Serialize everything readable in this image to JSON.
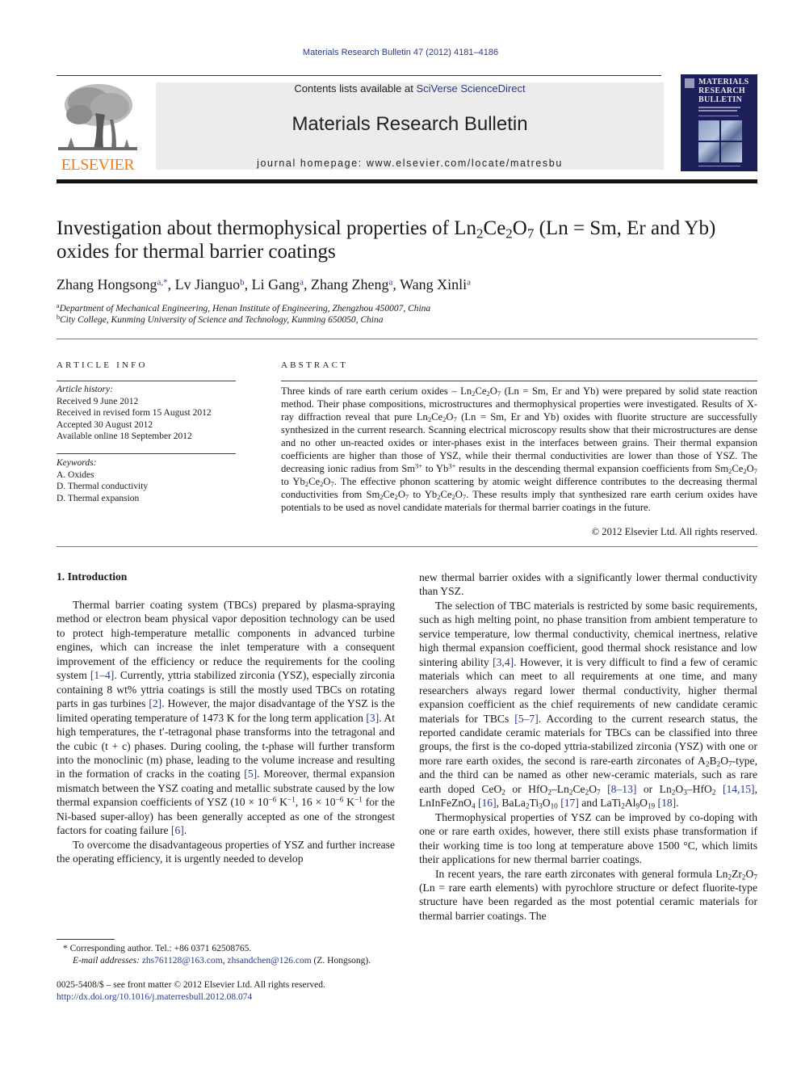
{
  "header": {
    "citation": "Materials Research Bulletin 47 (2012) 4181–4186",
    "publisher_wordmark": "ELSEVIER",
    "contents_prefix": "Contents lists available at ",
    "contents_link": "SciVerse ScienceDirect",
    "journal_title": "Materials Research Bulletin",
    "homepage": "journal homepage: www.elsevier.com/locate/matresbu",
    "cover_title": [
      "MATERIALS",
      "RESEARCH",
      "BULLETIN"
    ],
    "colors": {
      "link": "#2a3a8c",
      "elsevier_orange": "#f07d1a",
      "banner_bg": "#ececec",
      "cover_bg": "#1c1f5a"
    }
  },
  "article": {
    "title_parts": {
      "t1": "Investigation about thermophysical properties of Ln",
      "s1": "2",
      "t2": "Ce",
      "s2": "2",
      "t3": "O",
      "s3": "7",
      "t4": " (Ln = Sm, Er and Yb) oxides for thermal barrier coatings"
    },
    "authors": [
      {
        "name": "Zhang Hongsong",
        "aff": "a,*"
      },
      {
        "name": "Lv Jianguo",
        "aff": "b"
      },
      {
        "name": "Li Gang",
        "aff": "a"
      },
      {
        "name": "Zhang Zheng",
        "aff": "a"
      },
      {
        "name": "Wang Xinli",
        "aff": "a"
      }
    ],
    "affiliations": [
      {
        "key": "a",
        "text": "Department of Mechanical Engineering, Henan Institute of Engineering, Zhengzhou 450007, China"
      },
      {
        "key": "b",
        "text": "City College, Kunming University of Science and Technology, Kunming 650050, China"
      }
    ]
  },
  "article_info": {
    "label": "ARTICLE INFO",
    "history_heading": "Article history:",
    "history": [
      "Received 9 June 2012",
      "Received in revised form 15 August 2012",
      "Accepted 30 August 2012",
      "Available online 18 September 2012"
    ],
    "keywords_heading": "Keywords:",
    "keywords": [
      "A. Oxides",
      "D. Thermal conductivity",
      "D. Thermal expansion"
    ]
  },
  "abstract": {
    "label": "ABSTRACT",
    "p": {
      "a1": "Three kinds of rare earth cerium oxides – Ln",
      "a2": "Ce",
      "a3": "O",
      "a4": " (Ln = Sm, Er and Yb) were prepared by solid state reaction method. Their phase compositions, microstructures and thermophysical properties were investigated. Results of X-ray diffraction reveal that pure Ln",
      "a5": " (Ln = Sm, Er and Yb) oxides with fluorite structure are successfully synthesized in the current research. Scanning electrical microscopy results show that their microstructures are dense and no other un-reacted oxides or inter-phases exist in the interfaces between grains. Their thermal expansion coefficients are higher than those of YSZ, while their thermal conductivities are lower than those of YSZ. The decreasing ionic radius from Sm",
      "a6": " to Yb",
      "a7": " results in the descending thermal expansion coefficients from Sm",
      "a8": " to Yb",
      "a9": ". The effective phonon scattering by atomic weight difference contributes to the decreasing thermal conductivities from Sm",
      "a10": " to Yb",
      "a11": ". These results imply that synthesized rare earth cerium oxides have potentials to be used as novel candidate materials for thermal barrier coatings in the future.",
      "sub2": "2",
      "sub7": "7",
      "sup3": "3+"
    },
    "copyright": "© 2012 Elsevier Ltd. All rights reserved."
  },
  "body": {
    "section_heading": "1.  Introduction",
    "left": {
      "p1": {
        "t1": "Thermal barrier coating system (TBCs) prepared by plasma-spraying method or electron beam physical vapor deposition technology can be used to protect high-temperature metallic components in advanced turbine engines, which can increase the inlet temperature with a consequent improvement of the efficiency or reduce the requirements for the cooling system ",
        "r1": "[1–4]",
        "t2": ". Currently, yttria stabilized zirconia (YSZ), especially zirconia containing 8 wt% yttria coatings is still the mostly used TBCs on rotating parts in gas turbines ",
        "r2": "[2]",
        "t3": ". However, the major disadvantage of the YSZ is the limited operating temperature of 1473 K for the long term application ",
        "r3": "[3]",
        "t4": ". At high temperatures, the t′-tetragonal phase transforms into the tetragonal and the cubic (t + c) phases. During cooling, the t-phase will further transform into the monoclinic (m) phase, leading to the volume increase and resulting in the formation of cracks in the coating ",
        "r4": "[5]",
        "t5": ". Moreover, thermal expansion mismatch between the YSZ coating and metallic substrate caused by the low thermal expansion coefficients of YSZ (10 × 10",
        "e1": "−6",
        "t6": " K",
        "e2": "−1",
        "t7": ", 16 × 10",
        "t8": " for the Ni-based super-alloy) has been generally accepted as one of the strongest factors for coating failure ",
        "r5": "[6]",
        "t9": "."
      },
      "p2": "To overcome the disadvantageous properties of YSZ and further increase the operating efficiency, it is urgently needed to develop"
    },
    "right": {
      "p0": "new thermal barrier oxides with a significantly lower thermal conductivity than YSZ.",
      "p1": {
        "t1": "The selection of TBC materials is restricted by some basic requirements, such as high melting point, no phase transition from ambient temperature to service temperature, low thermal conductivity, chemical inertness, relative high thermal expansion coefficient, good thermal shock resistance and low sintering ability ",
        "r1": "[3,4]",
        "t2": ". However, it is very difficult to find a few of ceramic materials which can meet to all requirements at one time, and many researchers always regard lower thermal conductivity, higher thermal expansion coefficient as the chief requirements of new candidate ceramic materials for TBCs ",
        "r2": "[5–7]",
        "t3": ". According to the current research status, the reported candidate ceramic materials for TBCs can be classified into three groups, the first is the co-doped yttria-stabilized zirconia (YSZ) with one or more rare earth oxides, the second is rare-earth zirconates of A",
        "t4": "B",
        "t5": "O",
        "t6": "-type, and the third can be named as other new-ceramic materials, such as rare earth doped CeO",
        "t7": " or HfO",
        "t8": "–Ln",
        "t9": "Ce",
        "t10": "O",
        "r3": "[8–13]",
        "t11": " or Ln",
        "t12": "O",
        "t13": "–HfO",
        "r4": "[14,15]",
        "t14": "LnInFeZnO",
        "r5": "[16]",
        "t15": ", BaLa",
        "t16": "Ti",
        "t17": "O",
        "r6": "[17]",
        "t18": " and LaTi",
        "t19": "Al",
        "t20": "O",
        "r7": "[18]",
        "s2": "2",
        "s3": "3",
        "s4": "4",
        "s7": "7",
        "s9": "9",
        "s10": "10",
        "s19": "19"
      },
      "p2": "Thermophysical properties of YSZ can be improved by co-doping with one or rare earth oxides, however, there still exists phase transformation if their working time is too long at temperature above 1500 °C, which limits their applications for new thermal barrier coatings.",
      "p3": {
        "t1": "In recent years, the rare earth zirconates with general formula Ln",
        "t2": "Zr",
        "t3": "O",
        "t4": " (Ln = rare earth elements) with pyrochlore structure or defect fluorite-type structure have been regarded as the most potential ceramic materials for thermal barrier coatings. The"
      }
    }
  },
  "footnotes": {
    "corresponding": "* Corresponding author. Tel.: +86 0371 62508765.",
    "email_label": "E-mail addresses: ",
    "email1": "zhs761128@163.com",
    "email2": "zhsandchen@126.com",
    "email_suffix": " (Z. Hongsong).",
    "issn": "0025-5408/$ – see front matter © 2012 Elsevier Ltd. All rights reserved.",
    "doi": "http://dx.doi.org/10.1016/j.materresbull.2012.08.074"
  }
}
